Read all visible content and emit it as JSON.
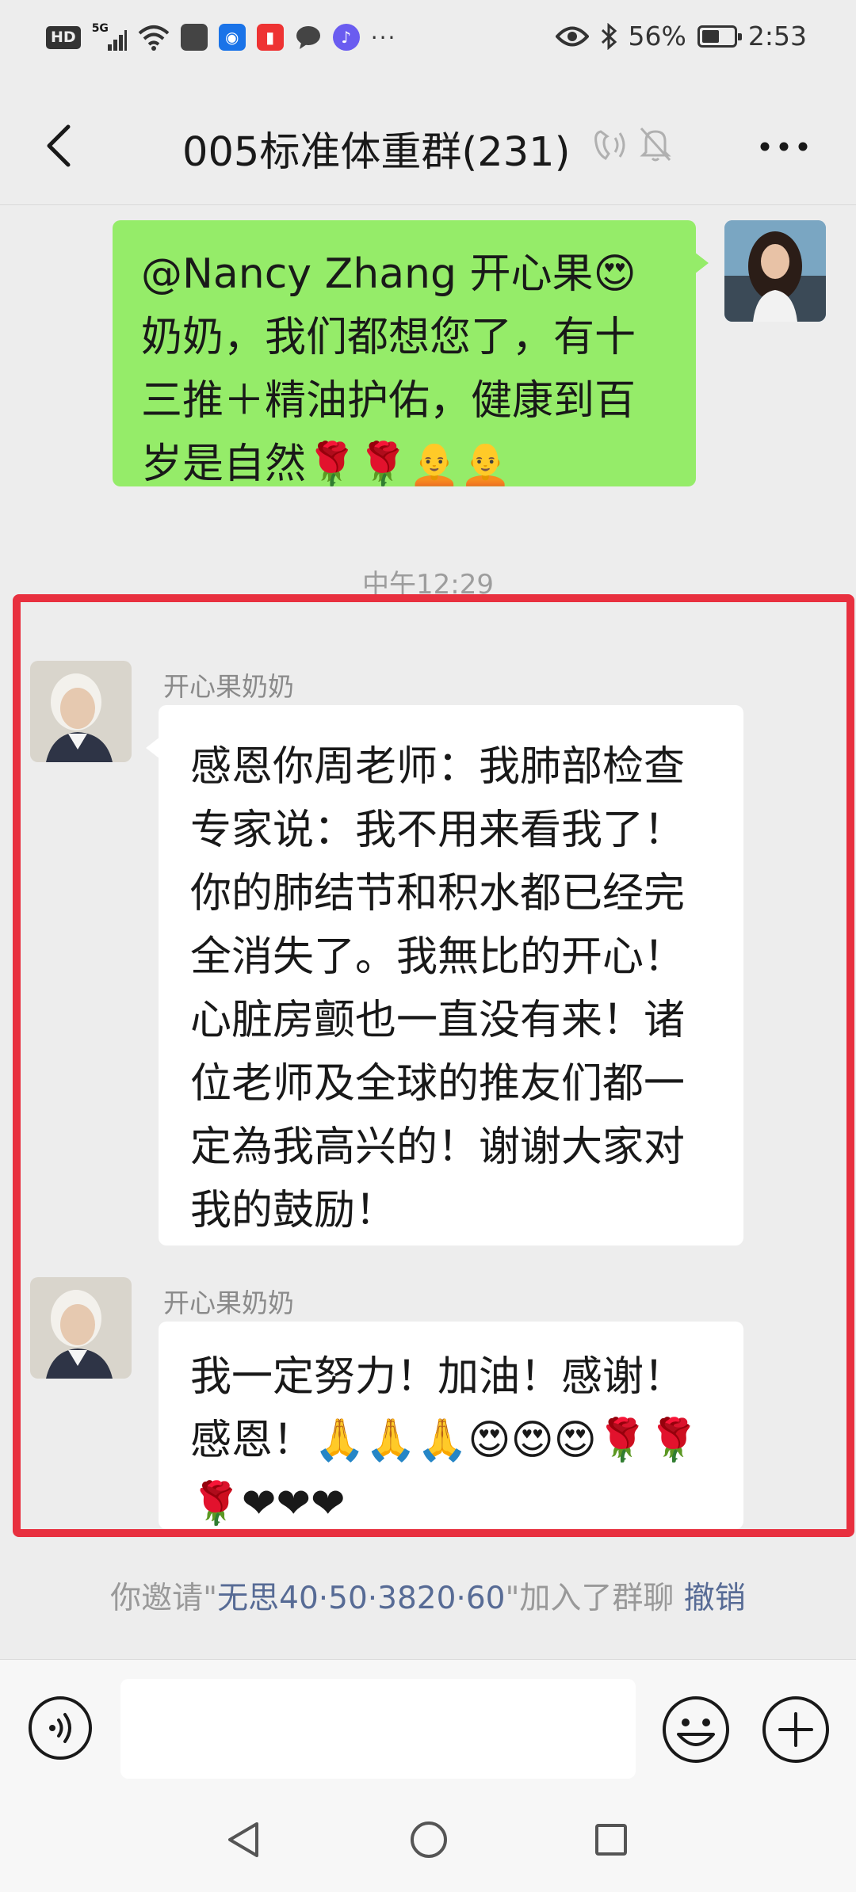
{
  "status_bar": {
    "hd": "HD",
    "network": "5G",
    "battery_text": "56%",
    "battery_level": 0.56,
    "time": "2:53",
    "more": "···"
  },
  "header": {
    "title": "005标准体重群(231)"
  },
  "messages": [
    {
      "side": "self",
      "text": "@Nancy Zhang 开心果😍\n奶奶，我们都想您了，有十\n三推＋精油护佑，健康到百\n岁是自然🌹🌹🧑‍🦲🧑‍🦲"
    },
    {
      "time": "中午12:29"
    },
    {
      "side": "other",
      "sender": "开心果奶奶",
      "text": "感恩你周老师：我肺部检查\n专家说：我不用来看我了！\n你的肺结节和积水都已经完\n全消失了。我無比的开心！\n心脏房颤也一直没有来！诸\n位老师及全球的推友们都一\n定為我高兴的！谢谢大家对\n我的鼓励！"
    },
    {
      "side": "other",
      "sender": "开心果奶奶",
      "text": "我一定努力！加油！感谢！\n感恩！🙏🙏🙏😍😍😍🌹🌹\n🌹❤❤❤"
    }
  ],
  "system_message": {
    "prefix": "你邀请\"",
    "name": "无思40·50·3820·60",
    "suffix": "\"加入了群聊  ",
    "revoke": "撤销"
  },
  "input_bar": {
    "placeholder": "",
    "voice_icon": "voice-icon",
    "emoji_icon": "emoji-icon",
    "plus_icon": "plus-icon"
  },
  "colors": {
    "self_bubble": "#95ec69",
    "other_bubble": "#ffffff",
    "highlight": "#e8303f",
    "link": "#576b95"
  }
}
